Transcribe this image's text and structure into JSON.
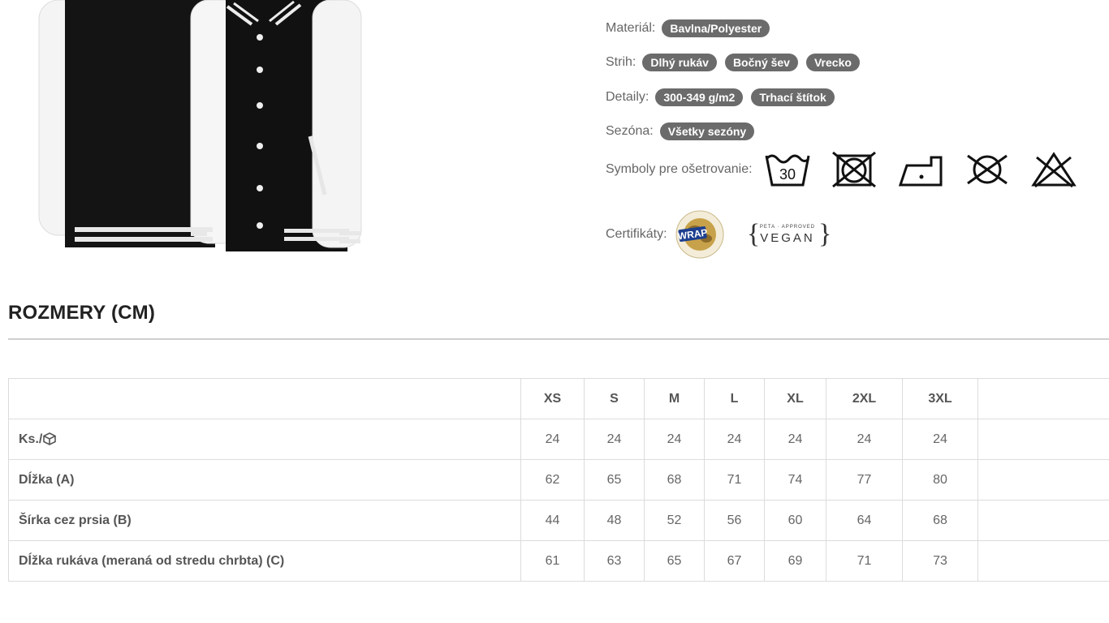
{
  "attributes": {
    "material_label": "Materiál:",
    "material_tags": [
      "Bavlna/Polyester"
    ],
    "cut_label": "Strih:",
    "cut_tags": [
      "Dlhý rukáv",
      "Bočný šev",
      "Vrecko"
    ],
    "details_label": "Detaily:",
    "details_tags": [
      "300-349 g/m2",
      "Trhací štítok"
    ],
    "season_label": "Sezóna:",
    "season_tags": [
      "Všetky sezóny"
    ],
    "care_label": "Symboly pre ošetrovanie:",
    "care_icons": [
      "wash-30-icon",
      "no-tumble-dry-icon",
      "iron-low-icon",
      "no-dry-clean-icon",
      "no-bleach-icon"
    ],
    "wash_temp": "30",
    "cert_label": "Certifikáty:",
    "cert_wrap_text": "WRAP",
    "cert_vegan_small": "PETA · APPROVED",
    "cert_vegan_text": "VEGAN"
  },
  "sizes": {
    "title": "ROZMERY (CM)",
    "columns": [
      "XS",
      "S",
      "M",
      "L",
      "XL",
      "2XL",
      "3XL"
    ],
    "rows": [
      {
        "label": "Ks./",
        "values": [
          "24",
          "24",
          "24",
          "24",
          "24",
          "24",
          "24"
        ]
      },
      {
        "label": "Dĺžka (A)",
        "values": [
          "62",
          "65",
          "68",
          "71",
          "74",
          "77",
          "80"
        ]
      },
      {
        "label": "Šírka cez prsia (B)",
        "values": [
          "44",
          "48",
          "52",
          "56",
          "60",
          "64",
          "68"
        ]
      },
      {
        "label": "Dĺžka rukáva (meraná od stredu chrbta) (C)",
        "values": [
          "61",
          "63",
          "65",
          "67",
          "69",
          "71",
          "73"
        ]
      }
    ]
  },
  "colors": {
    "tag_bg": "#6b6b6b",
    "title": "#222222",
    "rule": "#cfcfcf",
    "border": "#dcdcdc"
  }
}
